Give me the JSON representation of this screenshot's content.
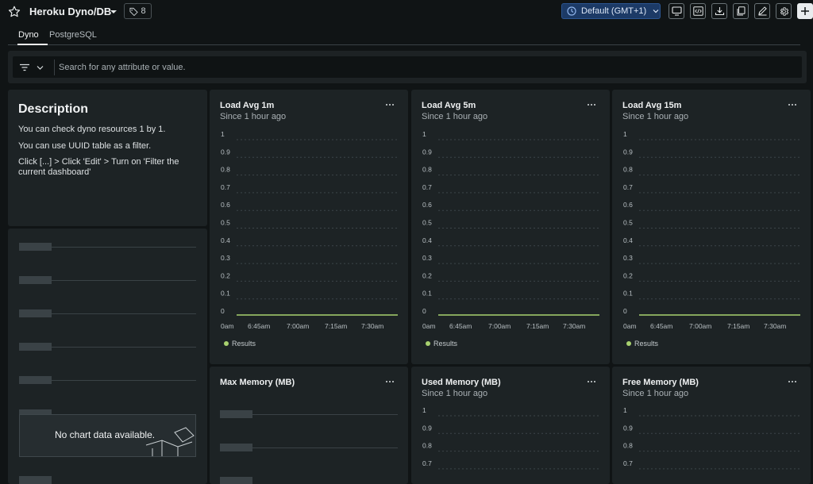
{
  "header": {
    "title": "Heroku Dyno/DB",
    "tag_count": "8",
    "timezone": "Default (GMT+1)"
  },
  "tabs": [
    {
      "label": "Dyno",
      "active": true
    },
    {
      "label": "PostgreSQL",
      "active": false
    }
  ],
  "search": {
    "placeholder": "Search for any attribute or value."
  },
  "description": {
    "title": "Description",
    "lines": [
      "You can check dyno resources 1 by 1.",
      "You can use UUID table as a filter.",
      "Click [...] > Click 'Edit' > Turn on 'Filter the current dashboard'"
    ]
  },
  "nodata": {
    "message": "No chart data available."
  },
  "legend_label": "Results",
  "chart_data": [
    {
      "type": "line",
      "title": "Load Avg 1m",
      "subtitle": "Since 1 hour ago",
      "yticks": [
        "1",
        "0.9",
        "0.8",
        "0.7",
        "0.6",
        "0.5",
        "0.4",
        "0.3",
        "0.2",
        "0.1",
        "0"
      ],
      "ylim": [
        0,
        1
      ],
      "xticks": [
        "0am",
        "6:45am",
        "7:00am",
        "7:15am",
        "7:30am"
      ],
      "series": [
        {
          "name": "Results",
          "color": "#a8d16f",
          "values": [
            0,
            0,
            0,
            0,
            0
          ]
        }
      ]
    },
    {
      "type": "line",
      "title": "Load Avg 5m",
      "subtitle": "Since 1 hour ago",
      "yticks": [
        "1",
        "0.9",
        "0.8",
        "0.7",
        "0.6",
        "0.5",
        "0.4",
        "0.3",
        "0.2",
        "0.1",
        "0"
      ],
      "ylim": [
        0,
        1
      ],
      "xticks": [
        "0am",
        "6:45am",
        "7:00am",
        "7:15am",
        "7:30am"
      ],
      "series": [
        {
          "name": "Results",
          "color": "#a8d16f",
          "values": [
            0,
            0,
            0,
            0,
            0
          ]
        }
      ]
    },
    {
      "type": "line",
      "title": "Load Avg 15m",
      "subtitle": "Since 1 hour ago",
      "yticks": [
        "1",
        "0.9",
        "0.8",
        "0.7",
        "0.6",
        "0.5",
        "0.4",
        "0.3",
        "0.2",
        "0.1",
        "0"
      ],
      "ylim": [
        0,
        1
      ],
      "xticks": [
        "0am",
        "6:45am",
        "7:00am",
        "7:15am",
        "7:30am"
      ],
      "series": [
        {
          "name": "Results",
          "color": "#a8d16f",
          "values": [
            0,
            0,
            0,
            0,
            0
          ]
        }
      ]
    },
    {
      "type": "line",
      "title": "Max Memory (MB)",
      "subtitle": "",
      "yticks": [],
      "xticks": [],
      "series": []
    },
    {
      "type": "line",
      "title": "Used Memory (MB)",
      "subtitle": "Since 1 hour ago",
      "yticks": [
        "1",
        "0.9",
        "0.8",
        "0.7"
      ],
      "ylim": [
        0.7,
        1
      ],
      "xticks": [],
      "series": []
    },
    {
      "type": "line",
      "title": "Free Memory (MB)",
      "subtitle": "Since 1 hour ago",
      "yticks": [
        "1",
        "0.9",
        "0.8",
        "0.7"
      ],
      "ylim": [
        0.7,
        1
      ],
      "xticks": [],
      "series": []
    }
  ],
  "colors": {
    "accent": "#1c3a66",
    "series": "#a8d16f",
    "panel": "#1d2325",
    "background": "#101415"
  }
}
